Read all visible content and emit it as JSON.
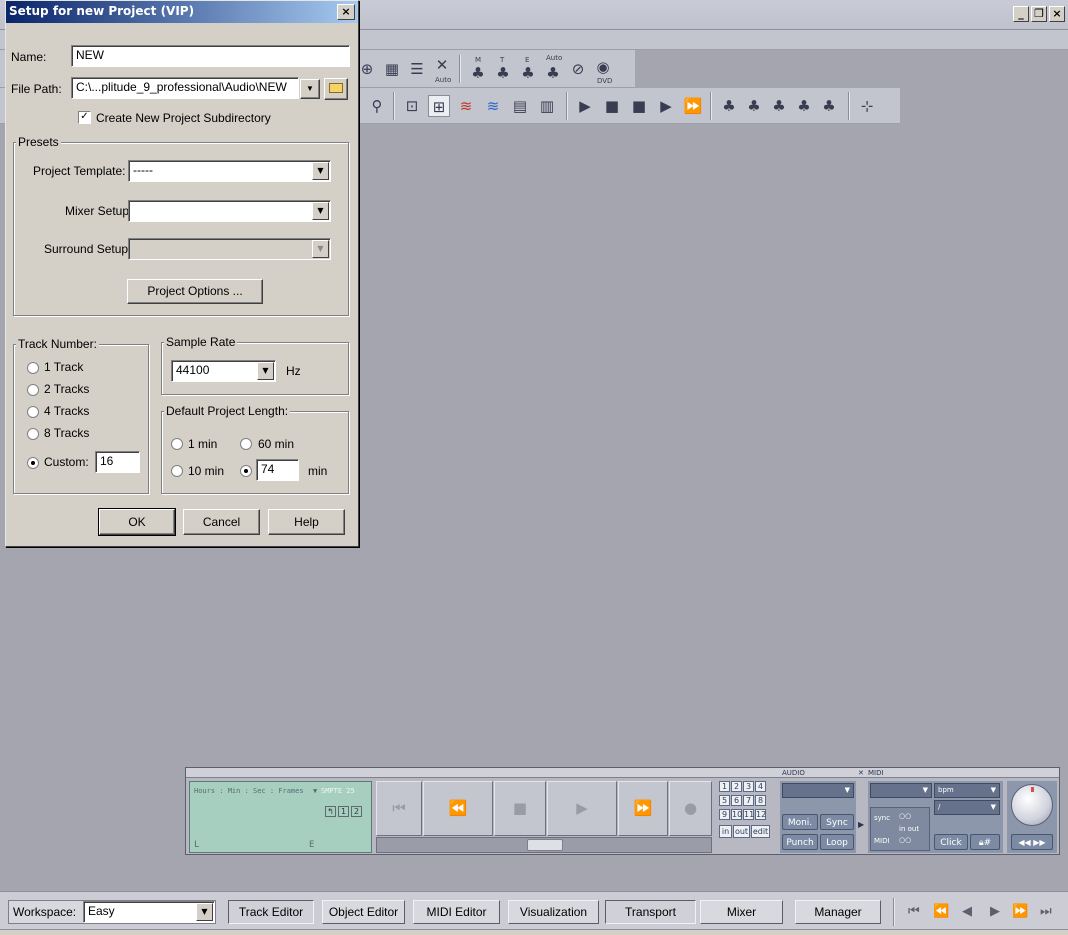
{
  "dialog": {
    "title": "Setup for new Project (VIP)",
    "close_icon": "close-icon",
    "name_label": "Name:",
    "name_value": "NEW",
    "filepath_label": "File Path:",
    "filepath_value": "C:\\...plitude_9_professional\\Audio\\NEW",
    "create_subdir_label": "Create New Project Subdirectory",
    "create_subdir_checked": true,
    "presets": {
      "legend": "Presets",
      "template_label": "Project Template:",
      "template_value": "-----",
      "mixer_label": "Mixer Setup:",
      "mixer_value": "",
      "surround_label": "Surround Setup:",
      "surround_value": "",
      "options_button": "Project Options ..."
    },
    "track_number": {
      "legend": "Track Number:",
      "options": [
        "1 Track",
        "2 Tracks",
        "4 Tracks",
        "8 Tracks"
      ],
      "custom_label": "Custom:",
      "custom_value": "16",
      "selected": "Custom:"
    },
    "sample_rate": {
      "legend": "Sample Rate",
      "value": "44100",
      "unit": "Hz"
    },
    "project_length": {
      "legend": "Default Project Length:",
      "opt_1min": "1 min",
      "opt_60min": "60 min",
      "opt_10min": "10 min",
      "custom_value": "74",
      "unit": "min",
      "selected": "custom"
    },
    "buttons": {
      "ok": "OK",
      "cancel": "Cancel",
      "help": "Help"
    }
  },
  "app_window": {
    "controls": [
      "minimize-icon",
      "restore-icon",
      "close-icon"
    ]
  },
  "toolbar": {
    "auto_label": "Auto",
    "m_label": "M",
    "t_label": "T",
    "e_label": "E",
    "auto2_label": "Auto",
    "dvd_label": "DVD"
  },
  "transport": {
    "display_header": "Hours : Min : Sec : Frames",
    "display_format": "SMPTE 25",
    "display_l": "L",
    "display_e": "E",
    "display_btn_1": "1",
    "display_btn_2": "2",
    "grid_numbers": [
      "1",
      "2",
      "3",
      "4",
      "5",
      "6",
      "7",
      "8",
      "9",
      "10",
      "11",
      "12"
    ],
    "grid_bottom": [
      "in",
      "out",
      "edit"
    ],
    "audio_label": "AUDIO",
    "midi_label": "MIDI",
    "moni": "Moni.",
    "sync": "Sync",
    "punch": "Punch",
    "loop": "Loop",
    "bpm": "bpm",
    "slash": "/",
    "sync_small": "sync",
    "in_out": "in  out",
    "midi_small": "MIDI",
    "click": "Click",
    "hash": "#"
  },
  "bottombar": {
    "workspace_label": "Workspace:",
    "workspace_value": "Easy",
    "tabs": [
      "Track Editor",
      "Object Editor",
      "MIDI Editor",
      "Visualization",
      "Transport",
      "Mixer",
      "Manager"
    ],
    "pressed_tabs": [
      "Track Editor",
      "Transport"
    ]
  },
  "colors": {
    "workspace_bg": "#a4a5ae",
    "dialog_title_start": "#0a246a",
    "dialog_title_end": "#a6caf0",
    "transport_display": "#a7cfc0"
  }
}
